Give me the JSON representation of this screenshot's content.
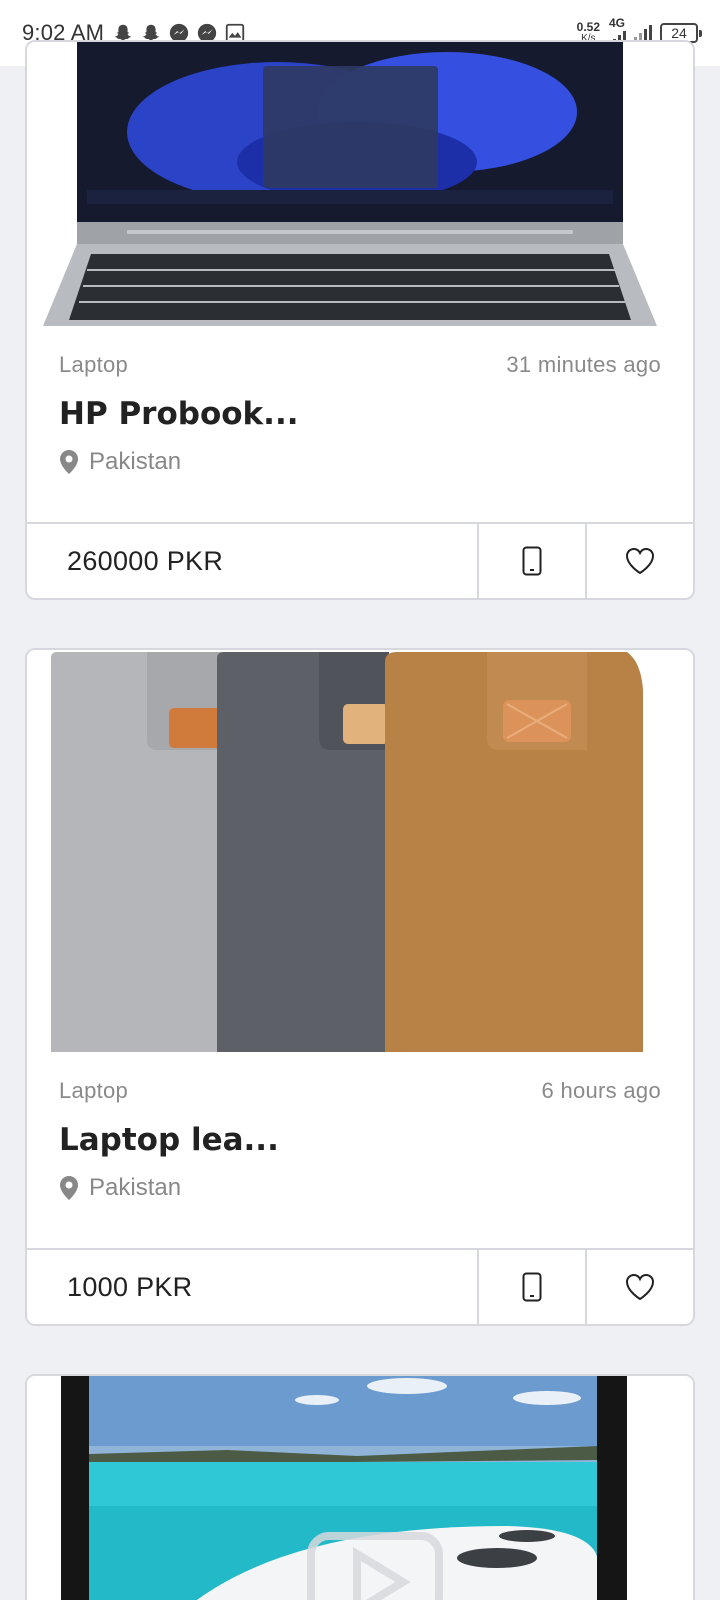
{
  "status_bar": {
    "time": "9:02 AM",
    "net_speed_value": "0.52",
    "net_speed_unit": "K/s",
    "network_type": "4G",
    "battery": "24",
    "notification_icons": [
      "snapchat-icon",
      "snapchat-icon",
      "messenger-icon",
      "messenger-icon",
      "gallery-icon"
    ]
  },
  "listings": [
    {
      "category": "Laptop",
      "time_ago": "31 minutes ago",
      "title": "HP Probook...",
      "location": "Pakistan",
      "price": "260000 PKR"
    },
    {
      "category": "Laptop",
      "time_ago": "6 hours ago",
      "title": "Laptop lea...",
      "location": "Pakistan",
      "price": "1000 PKR"
    }
  ],
  "icons": {
    "location": "location-pin-icon",
    "call": "phone-icon",
    "favorite": "heart-icon",
    "video": "play-icon"
  }
}
